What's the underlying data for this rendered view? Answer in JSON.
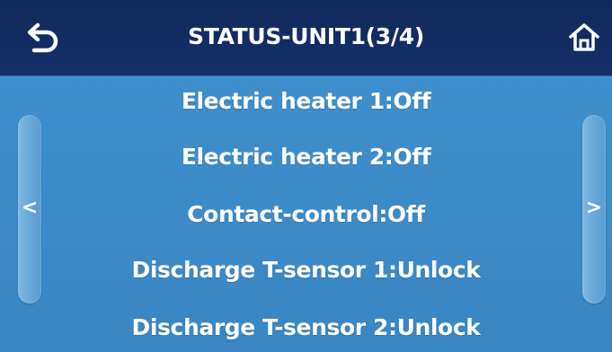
{
  "header": {
    "title": "STATUS-UNIT1(3/4)",
    "back_icon": "back-arrow-icon",
    "home_icon": "home-icon"
  },
  "status_items": [
    "Electric heater 1:Off",
    "Electric heater 2:Off",
    "Contact-control:Off",
    "Discharge T-sensor 1:Unlock",
    "Discharge T-sensor 2:Unlock"
  ],
  "nav": {
    "prev_glyph": "<",
    "next_glyph": ">"
  },
  "colors": {
    "header_bg": "#10295a",
    "content_bg": "#3d8dcb",
    "text": "#ffffff",
    "scroll_handle": "#6aaad8"
  }
}
